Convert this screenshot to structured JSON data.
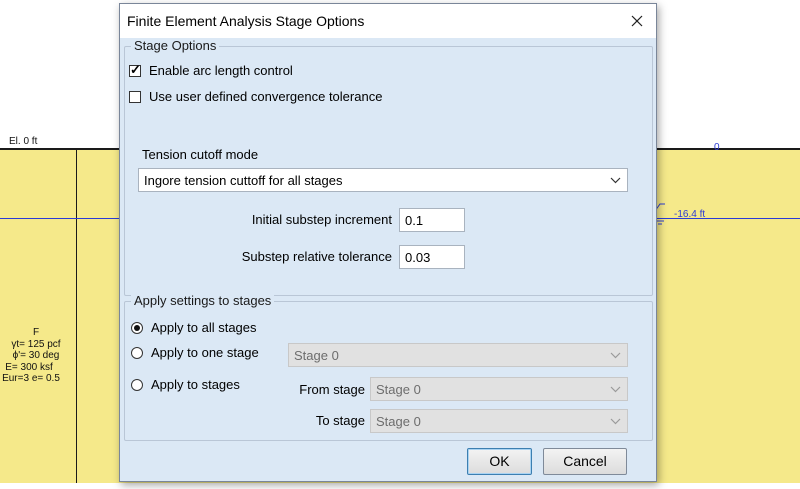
{
  "background": {
    "elevation_left": "El. 0 ft",
    "elevation_right": "0",
    "water_level": "-16.4 ft",
    "material": {
      "name": "F",
      "unit_weight": "γt= 125 pcf",
      "friction_angle": "ϕ'= 30 deg",
      "modulus": "E= 300 ksf",
      "eur": "Eur=3 e= 0.5"
    }
  },
  "dialog": {
    "title": "Finite Element Analysis Stage Options",
    "stage_options": {
      "legend": "Stage Options",
      "enable_arc_length": {
        "label": "Enable arc length control",
        "checked": true
      },
      "user_tolerance": {
        "label": "Use user defined convergence tolerance",
        "checked": false
      },
      "tension_cutoff_label": "Tension cutoff mode",
      "tension_cutoff_value": "Ingore tension cuttoff for all stages",
      "initial_substep_label": "Initial substep increment",
      "initial_substep_value": "0.1",
      "substep_tolerance_label": "Substep relative tolerance",
      "substep_tolerance_value": "0.03"
    },
    "apply_settings": {
      "legend": "Apply settings to stages",
      "all_stages": "Apply to all stages",
      "one_stage": "Apply to one stage",
      "one_stage_value": "Stage 0",
      "stages_range": "Apply to stages",
      "from_label": "From stage",
      "from_value": "Stage 0",
      "to_label": "To stage",
      "to_value": "Stage 0",
      "selected": "all"
    },
    "ok_label": "OK",
    "cancel_label": "Cancel"
  },
  "colors": {
    "soil": "#f5e98a",
    "dialog_client": "#dbe8f5",
    "water_line": "#2b3bd6"
  }
}
